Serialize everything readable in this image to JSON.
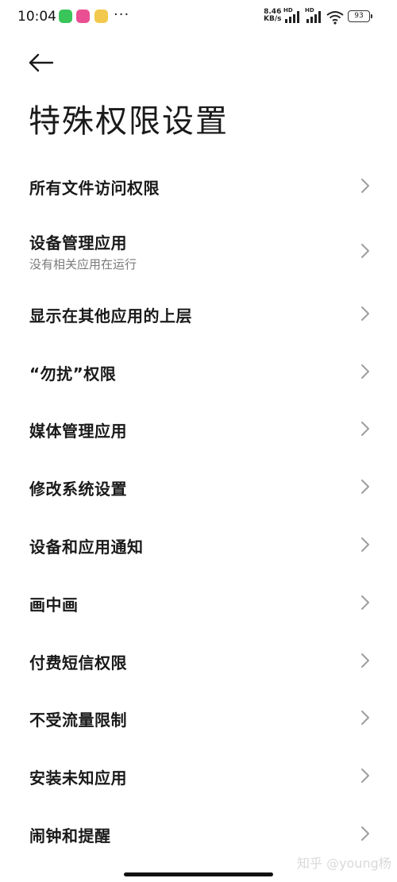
{
  "status_bar": {
    "time": "10:04",
    "net_speed_value": "8.46",
    "net_speed_unit": "KB/s",
    "hd_label_1": "HD",
    "hd_label_2": "HD",
    "battery": "93",
    "more_icons": "···",
    "app_icons": [
      "wechat-icon",
      "notification-app-icon",
      "weibo-icon"
    ]
  },
  "header": {
    "back_icon": "arrow-left-icon",
    "title": "特殊权限设置"
  },
  "settings": {
    "items": [
      {
        "label": "所有文件访问权限"
      },
      {
        "label": "设备管理应用",
        "subtitle": "没有相关应用在运行"
      },
      {
        "label": "显示在其他应用的上层"
      },
      {
        "label": "“勿扰”权限"
      },
      {
        "label": "媒体管理应用"
      },
      {
        "label": "修改系统设置"
      },
      {
        "label": "设备和应用通知"
      },
      {
        "label": "画中画"
      },
      {
        "label": "付费短信权限"
      },
      {
        "label": "不受流量限制"
      },
      {
        "label": "安装未知应用"
      },
      {
        "label": "闹钟和提醒"
      }
    ]
  },
  "watermark": "知乎 @young杨",
  "colors": {
    "text": "#1a1a1a",
    "subtext": "#7a7a7a",
    "chevron": "#9e9e9e",
    "background": "#ffffff"
  }
}
